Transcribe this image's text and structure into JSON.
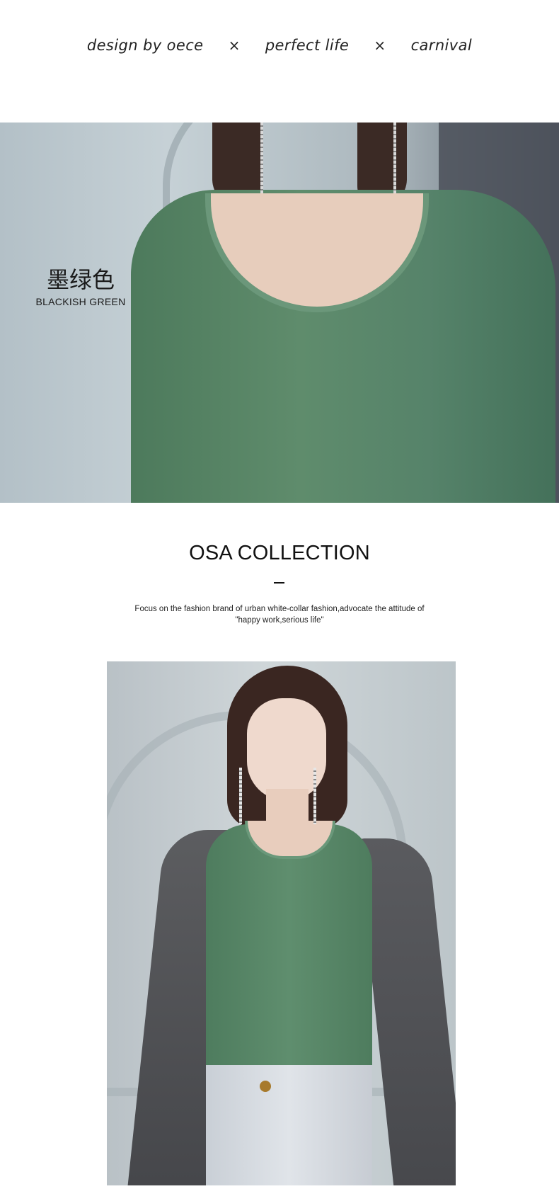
{
  "tagline": {
    "part1": "design by oece",
    "sep1": "×",
    "part2": "perfect life",
    "sep2": "×",
    "part3": "carnival"
  },
  "color": {
    "name_cn": "墨绿色",
    "name_en": "BLACKISH GREEN"
  },
  "collection": {
    "title": "OSA COLLECTION",
    "description_line1": "Focus on the fashion brand of urban white-collar fashion,advocate the attitude of",
    "description_line2": "\"happy work,serious life\""
  },
  "colors": {
    "shirt": "#5a8a6a",
    "text": "#111111"
  }
}
